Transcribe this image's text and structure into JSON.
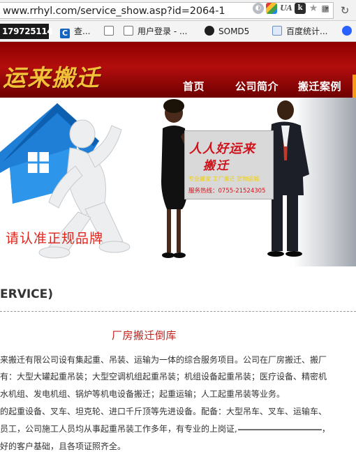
{
  "browser": {
    "url": "www.rrhyl.com/service_show.asp?id=2064-1",
    "extensions": [
      {
        "name": "globe-icon",
        "glyph": "◐"
      },
      {
        "name": "color-extension-icon",
        "glyph": ""
      },
      {
        "name": "ua-extension-icon",
        "glyph": "UA"
      },
      {
        "name": "k-extension-icon",
        "glyph": "k"
      },
      {
        "name": "star-icon",
        "glyph": "★"
      },
      {
        "name": "qr-icon",
        "glyph": "▦"
      }
    ],
    "reload_glyph": "↻",
    "chevron_glyph": "▾"
  },
  "bookmarks": {
    "first": "179725114",
    "items": [
      {
        "label": "查...",
        "icon": "c-app-icon",
        "glyph": "C"
      },
      {
        "label": "",
        "icon": "document-icon",
        "glyph": ""
      },
      {
        "label": "用户登录 - ...",
        "icon": "document-icon",
        "glyph": ""
      },
      {
        "label": "SOMD5",
        "icon": "somd5-icon",
        "glyph": ""
      },
      {
        "label": "百度统计...",
        "icon": "chart-icon",
        "glyph": ""
      },
      {
        "label": "",
        "icon": "baidu-icon",
        "glyph": ""
      }
    ]
  },
  "site": {
    "logo": "运来搬迁",
    "nav": [
      "首页",
      "公司简介",
      "搬迁案例"
    ]
  },
  "banner": {
    "slogan": "请认准正规品牌",
    "board_title": "人人好运来",
    "board_sub": "搬迁",
    "board_services": "专业搬家  工厂搬迁  货物运输",
    "board_hotline": "服务热线：0755-21524305"
  },
  "content": {
    "section_title": "ERVICE)",
    "article_title": "厂房搬迁倒库",
    "lines": [
      "来搬迁有限公司设有集起重、吊装、运输为一体的综合服务项目。公司在厂房搬迁、搬厂",
      "有：大型大罐起重吊装；大型空调机组起重吊装；机组设备起重吊装；医疗设备、精密机",
      "水机组、发电机组、锅炉等机电设备搬迁；起重运输；人工起重吊装等业务。",
      "的起重设备、叉车、坦克轮、进口千斤顶等先进设备。配备：大型吊车、叉车、运输车、",
      "员工，公司施工人员均从事起重吊装工作多年，有专业的上岗证,",
      "好的客户基础，且各项证照齐全。"
    ],
    "line5_tail": "，"
  },
  "colors": {
    "header_red": "#b30d0d",
    "logo_gold": "#f2c13a",
    "accent_red": "#c0221b",
    "nav_orange": "#f39c12"
  }
}
